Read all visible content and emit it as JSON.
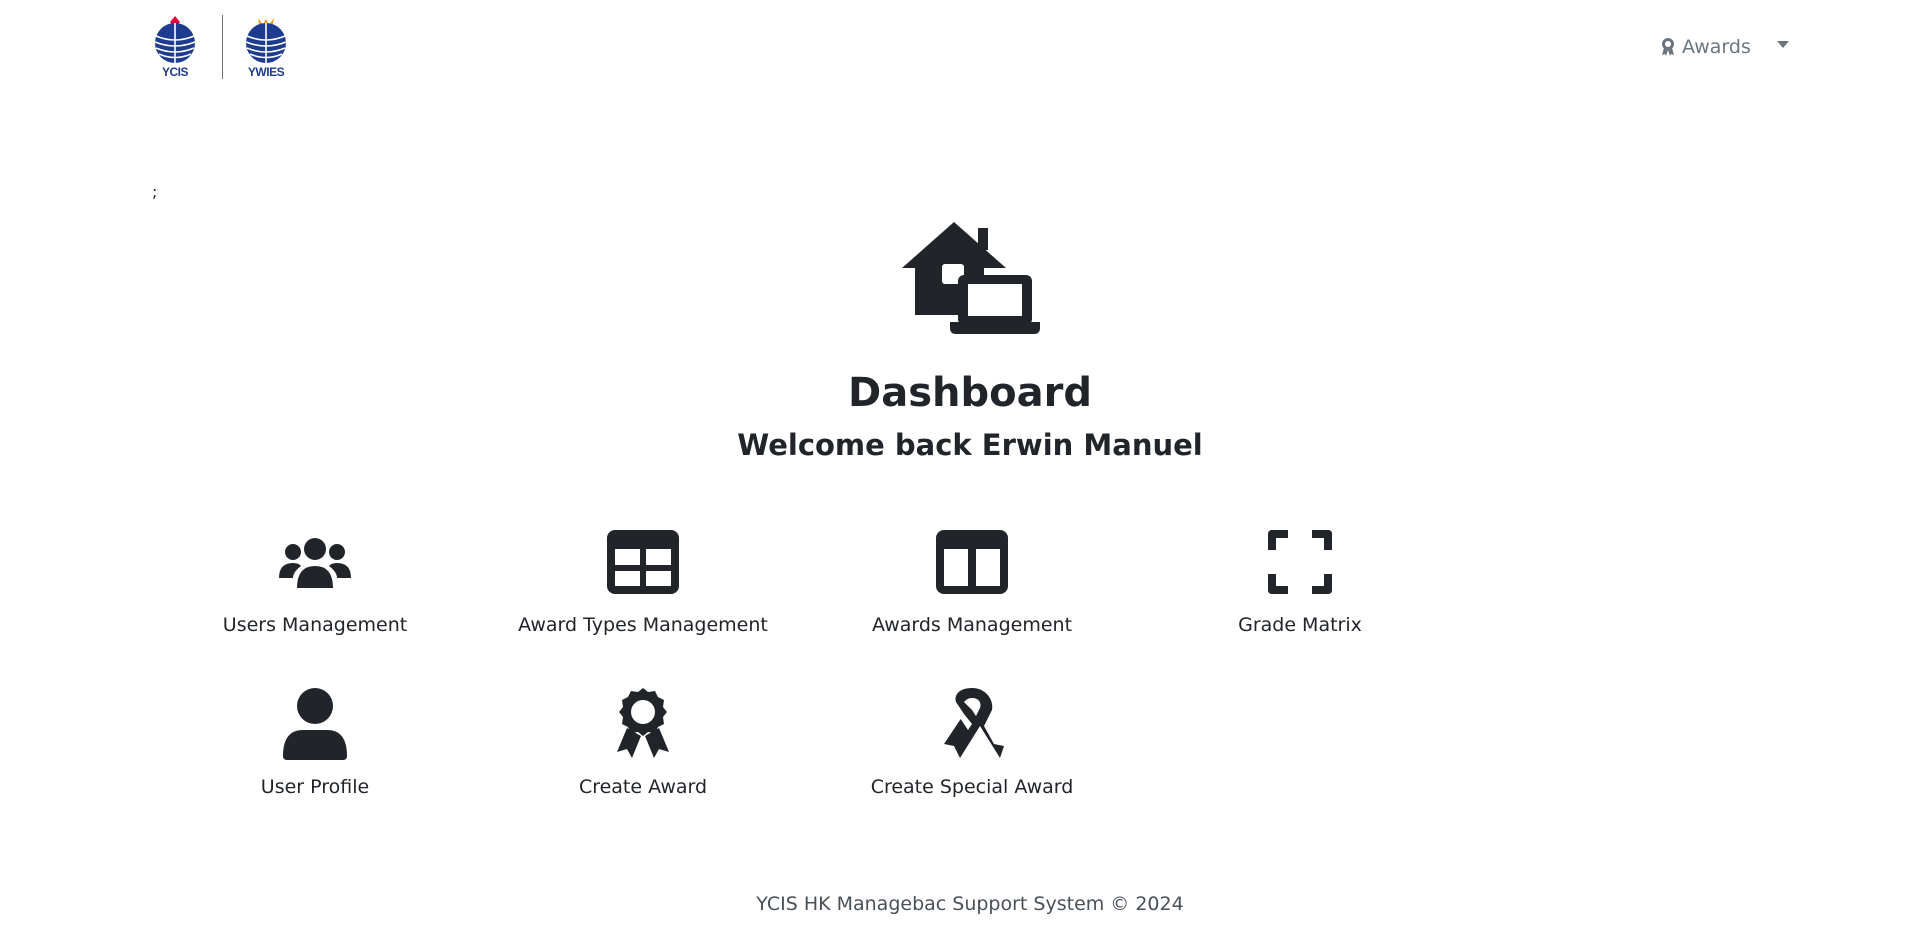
{
  "header": {
    "logos": [
      {
        "name": "ycis-logo",
        "text": "YCIS"
      },
      {
        "name": "ywies-logo",
        "text": "YWIES"
      }
    ],
    "nav": {
      "awards_label": "Awards",
      "icon": "award-icon"
    }
  },
  "stray_text": ";",
  "hero": {
    "icon": "house-laptop-icon",
    "title": "Dashboard",
    "welcome": "Welcome back Erwin Manuel"
  },
  "tiles": [
    {
      "label": "Users Management",
      "icon": "users-icon"
    },
    {
      "label": "Award Types Management",
      "icon": "table-icon"
    },
    {
      "label": "Awards Management",
      "icon": "columns-icon"
    },
    {
      "label": "Grade Matrix",
      "icon": "expand-icon"
    },
    {
      "label": "User Profile",
      "icon": "user-icon"
    },
    {
      "label": "Create Award",
      "icon": "award-icon"
    },
    {
      "label": "Create Special Award",
      "icon": "ribbon-icon"
    }
  ],
  "footer": {
    "text": "YCIS HK Managebac Support System © 2024"
  },
  "colors": {
    "text": "#212529",
    "muted": "#6c757d",
    "logo_blue": "#1d3b8f",
    "logo_red": "#e4003a",
    "logo_orange": "#f39200"
  }
}
